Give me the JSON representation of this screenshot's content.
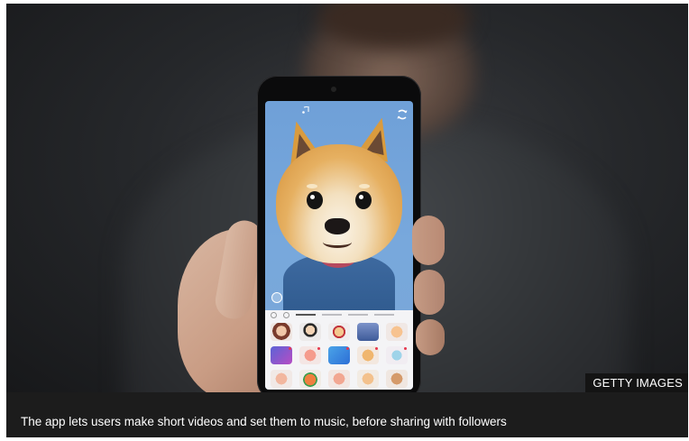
{
  "image": {
    "credit": "GETTY IMAGES",
    "caption": "The app lets users make short videos and set them to music, before sharing with followers"
  },
  "colors": {
    "caption_bar": "#1c1c1c",
    "credit_bg": "#141414",
    "caption_text": "#ffffff"
  },
  "icons": [
    "flip-camera-icon",
    "record-icon"
  ]
}
